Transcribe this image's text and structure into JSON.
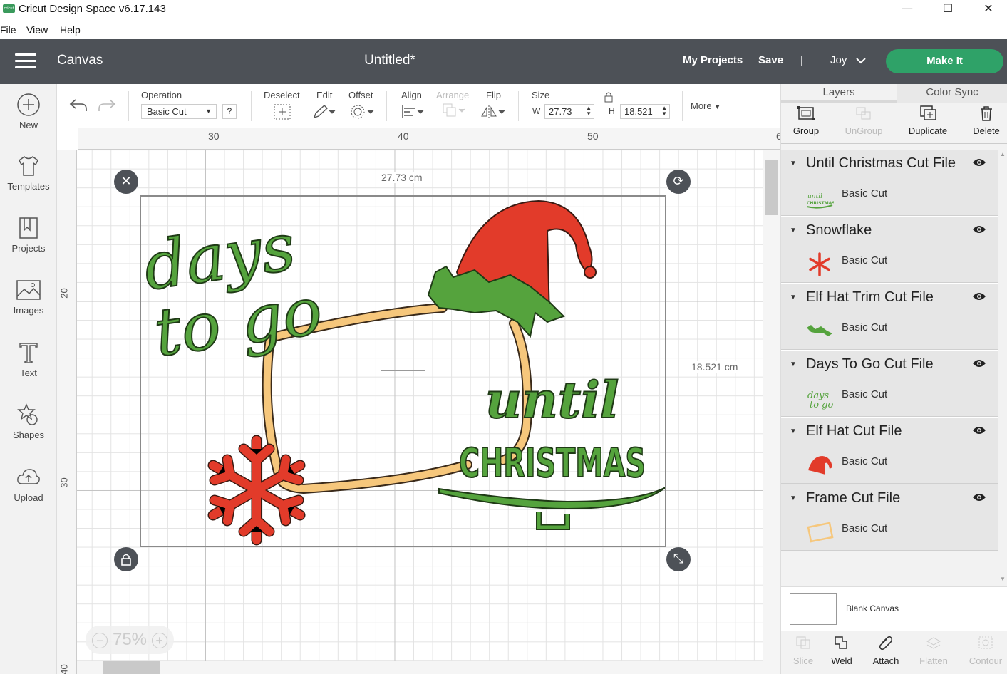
{
  "titlebar": {
    "app_title": "Cricut Design Space  v6.17.143",
    "logo_text": "cricut",
    "minimize": "—",
    "maximize": "☐",
    "close": "✕"
  },
  "menubar": {
    "items": [
      "File",
      "View",
      "Help"
    ]
  },
  "header": {
    "section": "Canvas",
    "doc_title": "Untitled*",
    "my_projects": "My Projects",
    "save": "Save",
    "divider": "|",
    "user": "Joy",
    "make_it": "Make It"
  },
  "leftbar": [
    {
      "label": "New",
      "icon": "plus-circle-icon"
    },
    {
      "label": "Templates",
      "icon": "shirt-icon"
    },
    {
      "label": "Projects",
      "icon": "projects-icon"
    },
    {
      "label": "Images",
      "icon": "image-icon"
    },
    {
      "label": "Text",
      "icon": "text-icon"
    },
    {
      "label": "Shapes",
      "icon": "shapes-icon"
    },
    {
      "label": "Upload",
      "icon": "upload-icon"
    }
  ],
  "toolbar": {
    "operation_label": "Operation",
    "operation_value": "Basic Cut",
    "help": "?",
    "deselect": "Deselect",
    "edit": "Edit",
    "offset": "Offset",
    "align": "Align",
    "arrange": "Arrange",
    "flip": "Flip",
    "size": "Size",
    "w_label": "W",
    "w_value": "27.73",
    "h_label": "H",
    "h_value": "18.521",
    "more": "More"
  },
  "canvas": {
    "ruler_h": [
      "30",
      "40",
      "50",
      "6"
    ],
    "ruler_v": [
      "20",
      "30",
      "40"
    ],
    "width_label": "27.73 cm",
    "height_label": "18.521 cm",
    "zoom": "75%",
    "design_text_1": "days",
    "design_text_2": "to go",
    "design_text_3": "until",
    "design_text_4": "CHRISTMAS",
    "colors": {
      "green": "#55a33d",
      "red": "#e23b2a",
      "tan": "#f6c77c"
    }
  },
  "rightpanel": {
    "tabs": [
      "Layers",
      "Color Sync"
    ],
    "actions": [
      "Group",
      "UnGroup",
      "Duplicate",
      "Delete"
    ],
    "layers": [
      {
        "name": "Until Christmas Cut File",
        "op": "Basic Cut"
      },
      {
        "name": "Snowflake",
        "op": "Basic Cut"
      },
      {
        "name": "Elf Hat Trim Cut File",
        "op": "Basic Cut"
      },
      {
        "name": "Days To Go Cut File",
        "op": "Basic Cut"
      },
      {
        "name": "Elf Hat Cut File",
        "op": "Basic Cut"
      },
      {
        "name": "Frame Cut File",
        "op": "Basic Cut"
      }
    ],
    "blank_canvas": "Blank Canvas",
    "bottom_actions": [
      "Slice",
      "Weld",
      "Attach",
      "Flatten",
      "Contour"
    ]
  }
}
